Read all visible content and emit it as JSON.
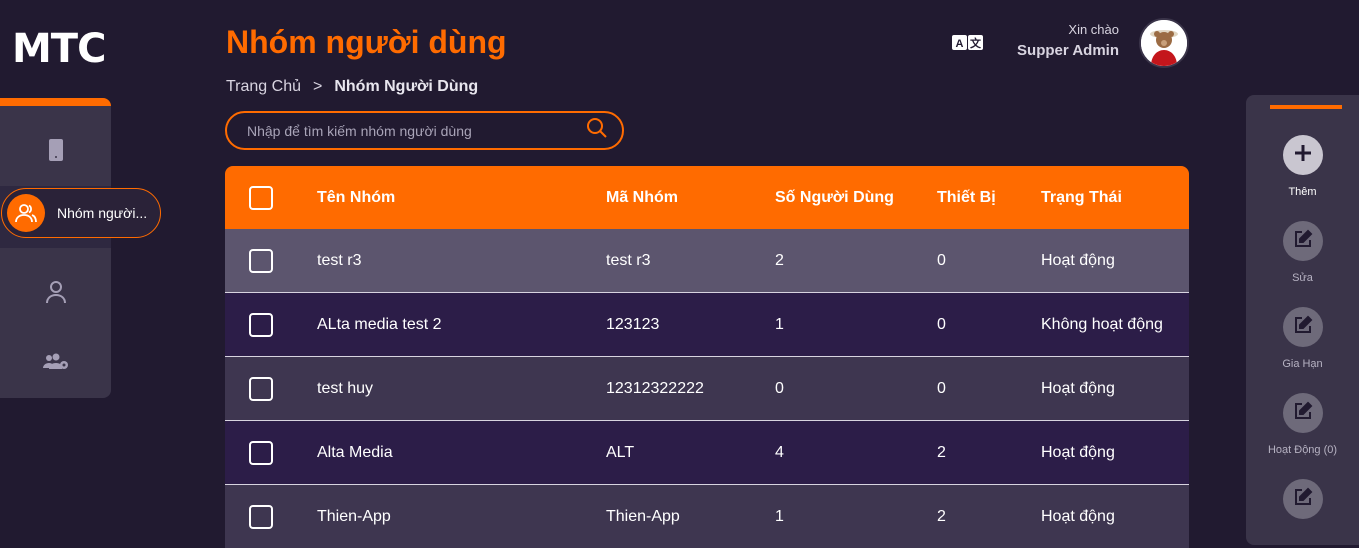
{
  "app": {
    "logo": "MTC"
  },
  "sidebar": {
    "active_label": "Nhóm người..."
  },
  "header": {
    "title": "Nhóm người dùng",
    "breadcrumb": {
      "home": "Trang Chủ",
      "separator": ">",
      "current": "Nhóm Người Dùng"
    },
    "greeting": "Xin chào",
    "user_name": "Supper Admin"
  },
  "search": {
    "placeholder": "Nhập để tìm kiếm nhóm người dùng",
    "value": ""
  },
  "table": {
    "headers": [
      "Tên Nhóm",
      "Mã Nhóm",
      "Số Người Dùng",
      "Thiết Bị",
      "Trạng Thái"
    ],
    "rows": [
      [
        "test r3",
        "test r3",
        "2",
        "0",
        "Hoạt động"
      ],
      [
        "ALta media test 2",
        "123123",
        "1",
        "0",
        "Không hoạt động"
      ],
      [
        "test huy",
        "12312322222",
        "0",
        "0",
        "Hoạt động"
      ],
      [
        "Alta Media",
        "ALT",
        "4",
        "2",
        "Hoạt động"
      ],
      [
        "Thien-App",
        "Thien-App",
        "1",
        "2",
        "Hoạt động"
      ]
    ]
  },
  "actions": [
    {
      "label": "Thêm",
      "icon": "plus-icon"
    },
    {
      "label": "Sửa",
      "icon": "edit-icon"
    },
    {
      "label": "Gia Hạn",
      "icon": "edit-icon"
    },
    {
      "label": "Hoạt Động (0)",
      "icon": "edit-icon"
    },
    {
      "label": "",
      "icon": "edit-icon"
    }
  ],
  "colors": {
    "accent": "#ff6b00",
    "background": "#211a30",
    "panel": "#3a3449"
  }
}
